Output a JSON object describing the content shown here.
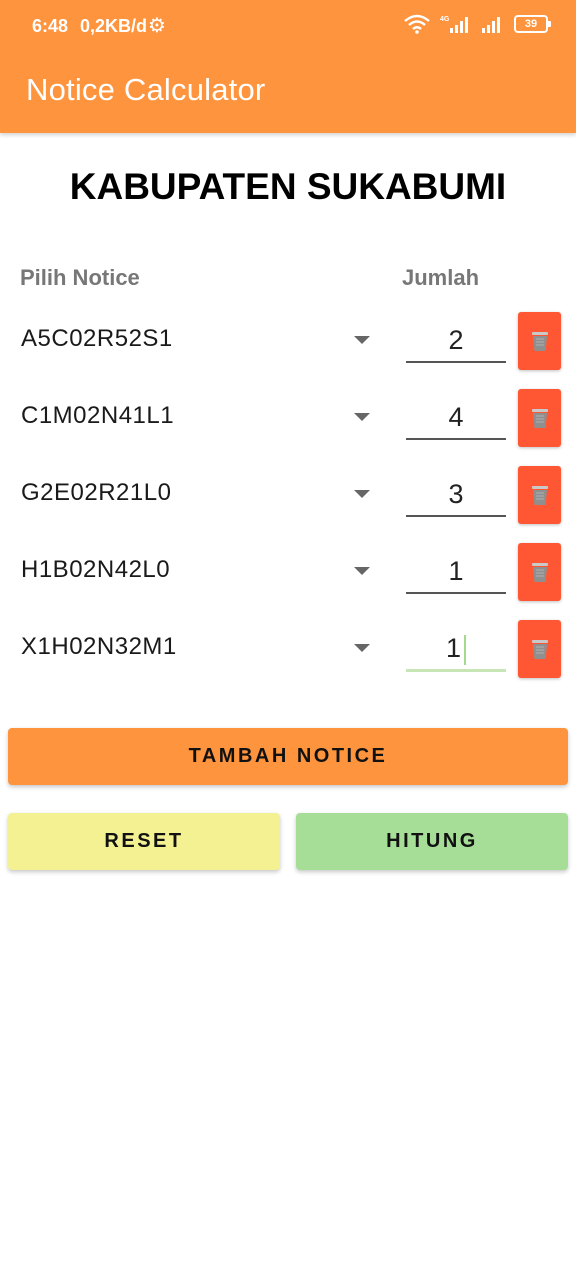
{
  "status_bar": {
    "time": "6:48",
    "data_speed": "0,2KB/d",
    "network_label": "4G",
    "battery": "39"
  },
  "app_bar": {
    "title": "Notice Calculator"
  },
  "heading": "KABUPATEN SUKABUMI",
  "columns": {
    "notice": "Pilih Notice",
    "amount": "Jumlah"
  },
  "rows": [
    {
      "code": "A5C02R52S1",
      "qty": "2"
    },
    {
      "code": "C1M02N41L1",
      "qty": "4"
    },
    {
      "code": "G2E02R21L0",
      "qty": "3"
    },
    {
      "code": "H1B02N42L0",
      "qty": "1"
    },
    {
      "code": "X1H02N32M1",
      "qty": "1"
    }
  ],
  "buttons": {
    "add": "TAMBAH NOTICE",
    "reset": "RESET",
    "calculate": "HITUNG"
  },
  "colors": {
    "primary": "#FF943E",
    "delete": "#FF5733",
    "reset": "#F4F193",
    "calculate": "#A6DE98"
  },
  "icons": {
    "settings": "gear-icon",
    "wifi": "wifi-icon",
    "signal": "signal-icon",
    "battery": "battery-icon",
    "dropdown": "dropdown-arrow-icon",
    "delete": "trash-icon"
  }
}
